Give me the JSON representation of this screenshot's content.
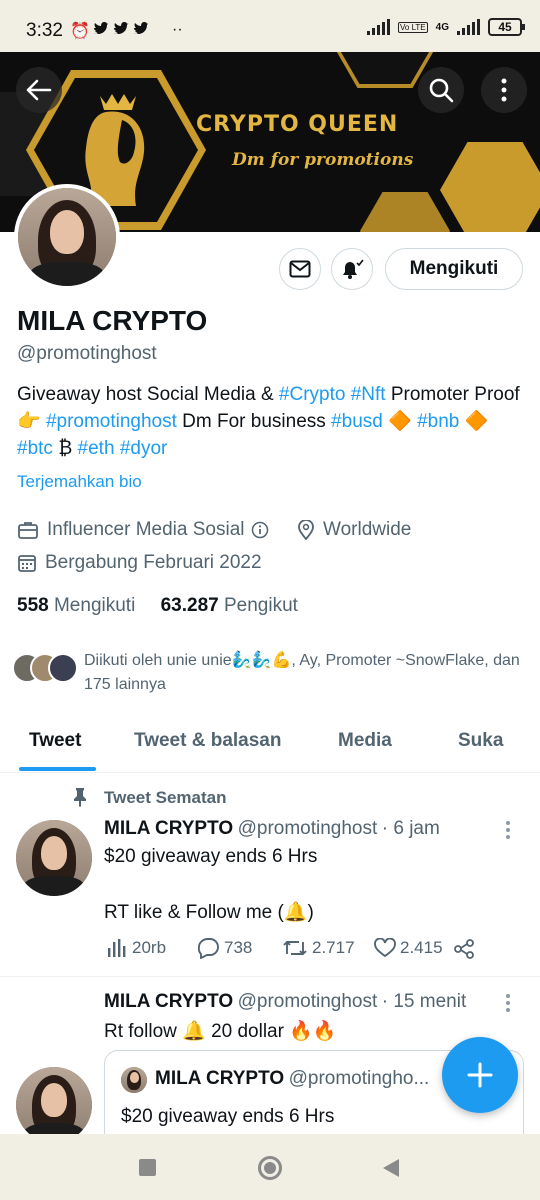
{
  "status_bar": {
    "time": "3:32",
    "network": "4G",
    "volte": "Vo LTE",
    "battery": "45"
  },
  "banner": {
    "title": "CRYPTO QUEEN",
    "subtitle": "Dm for promotions"
  },
  "profile": {
    "follow_button": "Mengikuti",
    "name": "MILA CRYPTO",
    "handle": "@promotinghost",
    "bio_parts": [
      "Giveaway host Social Media & ",
      "#Crypto",
      " ",
      "#Nft",
      " Promoter Proof 👉 ",
      "#promotinghost",
      " Dm For business ",
      "#busd",
      " 🔶 ",
      "#bnb",
      " 🔶  ",
      "#btc",
      " ₿  ",
      "#eth",
      " ",
      "#dyor"
    ],
    "translate_label": "Terjemahkan bio",
    "category": "Influencer Media Sosial",
    "location": "Worldwide",
    "joined": "Bergabung Februari 2022",
    "following_count": "558",
    "following_label": "Mengikuti",
    "followers_count": "63.287",
    "followers_label": "Pengikut",
    "followed_by": "Diikuti oleh unie unie🧞‍♂️🧞‍♂️💪, Ay, Promoter ~SnowFlake, dan 175 lainnya"
  },
  "tabs": [
    {
      "label": "Tweet",
      "active": true
    },
    {
      "label": "Tweet & balasan",
      "active": false
    },
    {
      "label": "Media",
      "active": false
    },
    {
      "label": "Suka",
      "active": false
    }
  ],
  "pinned_label": "Tweet Sematan",
  "tweets": [
    {
      "name": "MILA CRYPTO",
      "handle": "@promotinghost",
      "time": "· 6 jam",
      "text_line1": "$20 giveaway ends 6 Hrs",
      "text_line2": "RT like & Follow me (🔔)",
      "views": "20rb",
      "replies": "738",
      "retweets": "2.717",
      "likes": "2.415"
    },
    {
      "name": "MILA CRYPTO",
      "handle": "@promotinghost",
      "time": "· 15 menit",
      "text_line1": "Rt follow 🔔 20 dollar 🔥🔥",
      "quote_name": "MILA CRYPTO",
      "quote_handle": "@promotingho...",
      "quote_text": "$20 giveaway ends 6 Hrs"
    }
  ],
  "colors": {
    "accent": "#1d9bf0",
    "gold": "#c99a2c",
    "text": "#0f1419",
    "muted": "#536471"
  }
}
